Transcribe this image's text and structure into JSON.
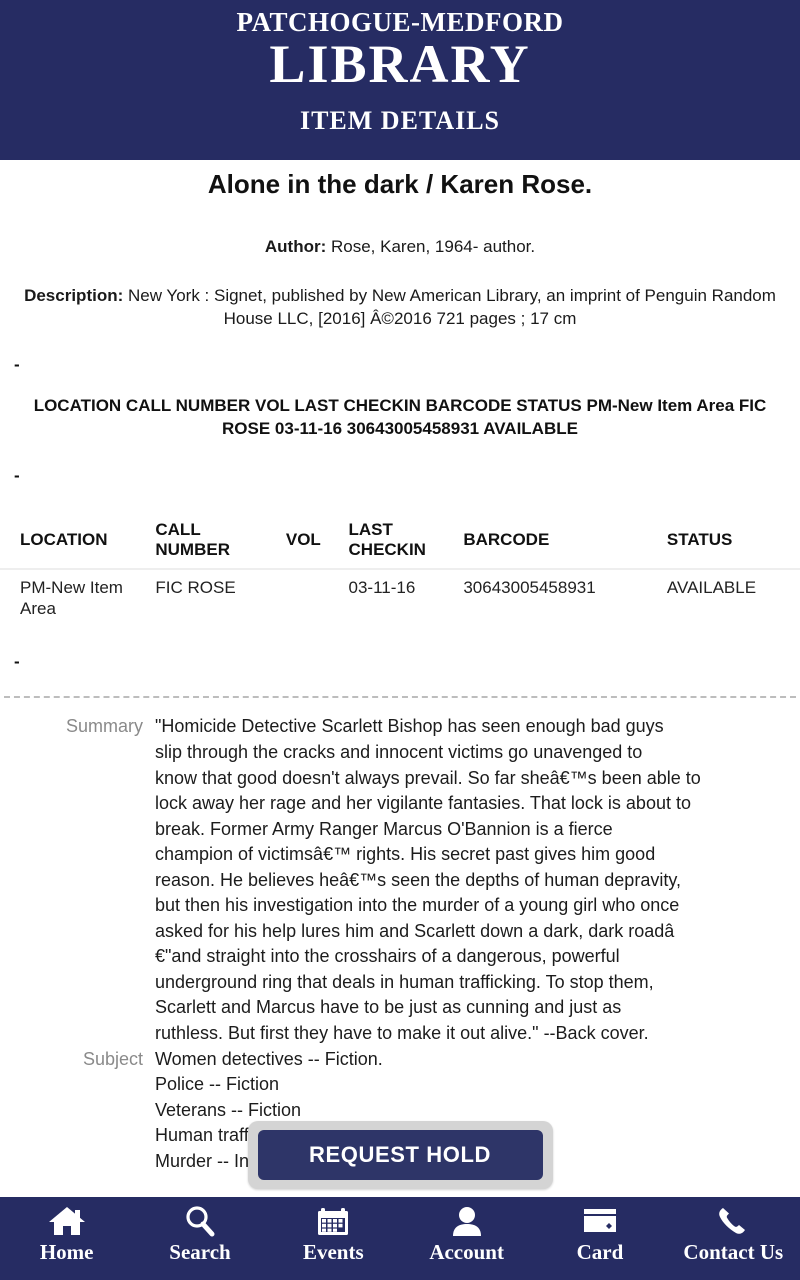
{
  "header": {
    "sub_title": "PATCHOGUE-MEDFORD",
    "main_title": "LIBRARY",
    "page_title": "ITEM DETAILS",
    "bg_color": "#262c63"
  },
  "item": {
    "title": "Alone in the dark / Karen Rose.",
    "author_label": "Author:",
    "author_value": "Rose, Karen, 1964- author.",
    "description_label": "Description:",
    "description_value": "New York : Signet, published by New American Library, an imprint of Penguin Random House LLC, [2016] Â©2016 721 pages ; 17 cm",
    "dash_marker": "-",
    "runon_text": "LOCATION CALL NUMBER VOL LAST CHECKIN BARCODE STATUS  PM-New Item Area  FIC ROSE 03-11-16  30643005458931  AVAILABLE"
  },
  "holdings": {
    "columns": [
      "LOCATION",
      "CALL NUMBER",
      "VOL",
      "LAST CHECKIN",
      "BARCODE",
      "STATUS"
    ],
    "rows": [
      {
        "location": "PM-New Item Area",
        "call_number": "FIC ROSE",
        "vol": "",
        "last_checkin": "03-11-16",
        "barcode": "30643005458931",
        "status": "AVAILABLE"
      }
    ]
  },
  "details": {
    "summary_label": "Summary",
    "summary_lines": [
      "\"Homicide Detective Scarlett Bishop has seen enough bad guys",
      "slip through the cracks and innocent victims go unavenged to",
      "know that good doesn't always prevail. So far sheâ€™s been able to",
      "lock away her rage and her vigilante fantasies. That lock is about to",
      "break. Former Army Ranger Marcus O'Bannion is a fierce",
      "champion of victimsâ€™ rights. His secret past gives him good",
      "reason. He believes heâ€™s seen the depths of human depravity,",
      "but then his investigation into the murder of a young girl who once",
      "asked for his help lures him and Scarlett down a dark, dark roadâ",
      "€\"and straight into the crosshairs of a dangerous, powerful",
      "underground ring that deals in human trafficking. To stop them,",
      "Scarlett and Marcus have to be just as cunning and just as",
      "ruthless. But first they have to make it out alive.\" --Back cover."
    ],
    "subject_label": "Subject",
    "subject_lines": [
      "Women detectives -- Fiction.",
      "Police -- Fiction",
      "Veterans -- Fiction",
      "Human trafficking -- Fiction.",
      "Murder -- Investigation -- Fiction."
    ]
  },
  "actions": {
    "request_hold_label": "REQUEST HOLD",
    "button_color": "#2e3568"
  },
  "footer_nav": [
    {
      "label": "Home",
      "icon": "home-icon"
    },
    {
      "label": "Search",
      "icon": "search-icon"
    },
    {
      "label": "Events",
      "icon": "calendar-icon"
    },
    {
      "label": "Account",
      "icon": "person-icon"
    },
    {
      "label": "Card",
      "icon": "credit-card-icon"
    },
    {
      "label": "Contact Us",
      "icon": "phone-icon"
    }
  ]
}
